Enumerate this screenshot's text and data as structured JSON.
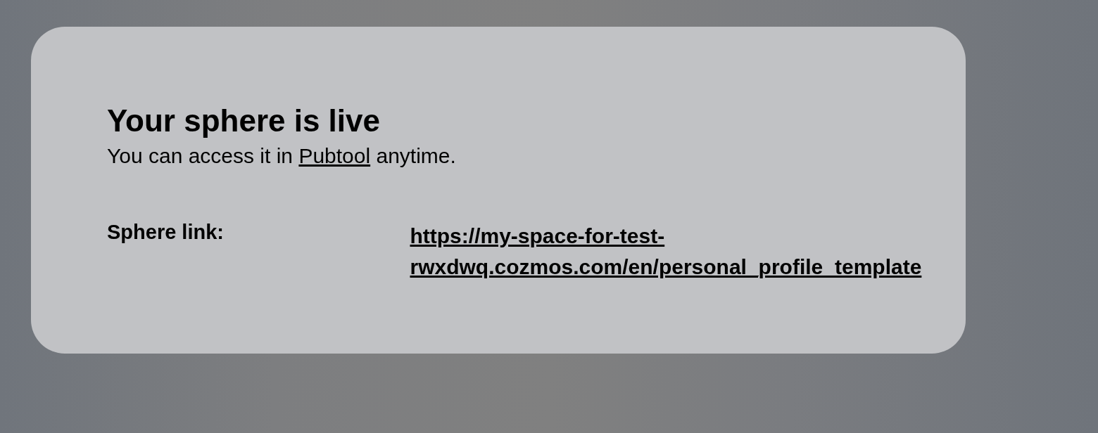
{
  "dialog": {
    "title": "Your sphere is live",
    "message": {
      "before": "You can access it in",
      "link": "Pubtool",
      "after": "anytime."
    },
    "field": {
      "label": "Sphere link:",
      "value": "https://my-space-for-test-rwxdwq.cozmos.com/en/personal_profile_template"
    }
  }
}
